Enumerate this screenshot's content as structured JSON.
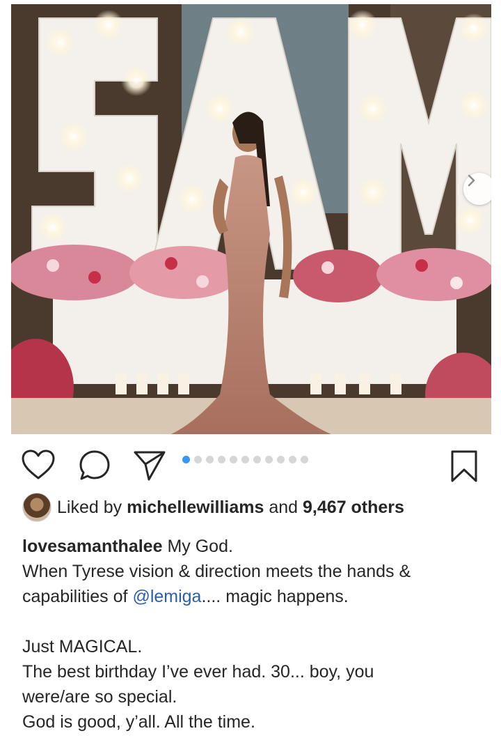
{
  "post": {
    "marquee_letters": [
      "S",
      "A",
      "M"
    ],
    "carousel": {
      "total": 11,
      "active_index": 0
    }
  },
  "likes": {
    "prefix": "Liked by",
    "user": "michellewilliams",
    "middle": "and",
    "count": "9,467 others"
  },
  "caption": {
    "username": "lovesamanthalee",
    "first_text": "My God.",
    "line2": "When Tyrese vision & direction meets the hands &",
    "line3_prefix": "capabilities of",
    "mention": "@lemiga",
    "line3_suffix": ".... magic happens.",
    "line4": "Just MAGICAL.",
    "line5": "The best birthday I’ve ever had. 30... boy, you",
    "line6": "were/are so special.",
    "line7": "God is good, y’all. All the time."
  },
  "icons": [
    "heart-icon",
    "comment-icon",
    "share-icon",
    "bookmark-icon",
    "chevron-right-icon"
  ],
  "colors": {
    "accent": "#3897f0",
    "mention": "#2b5fa8",
    "text": "#262626"
  }
}
